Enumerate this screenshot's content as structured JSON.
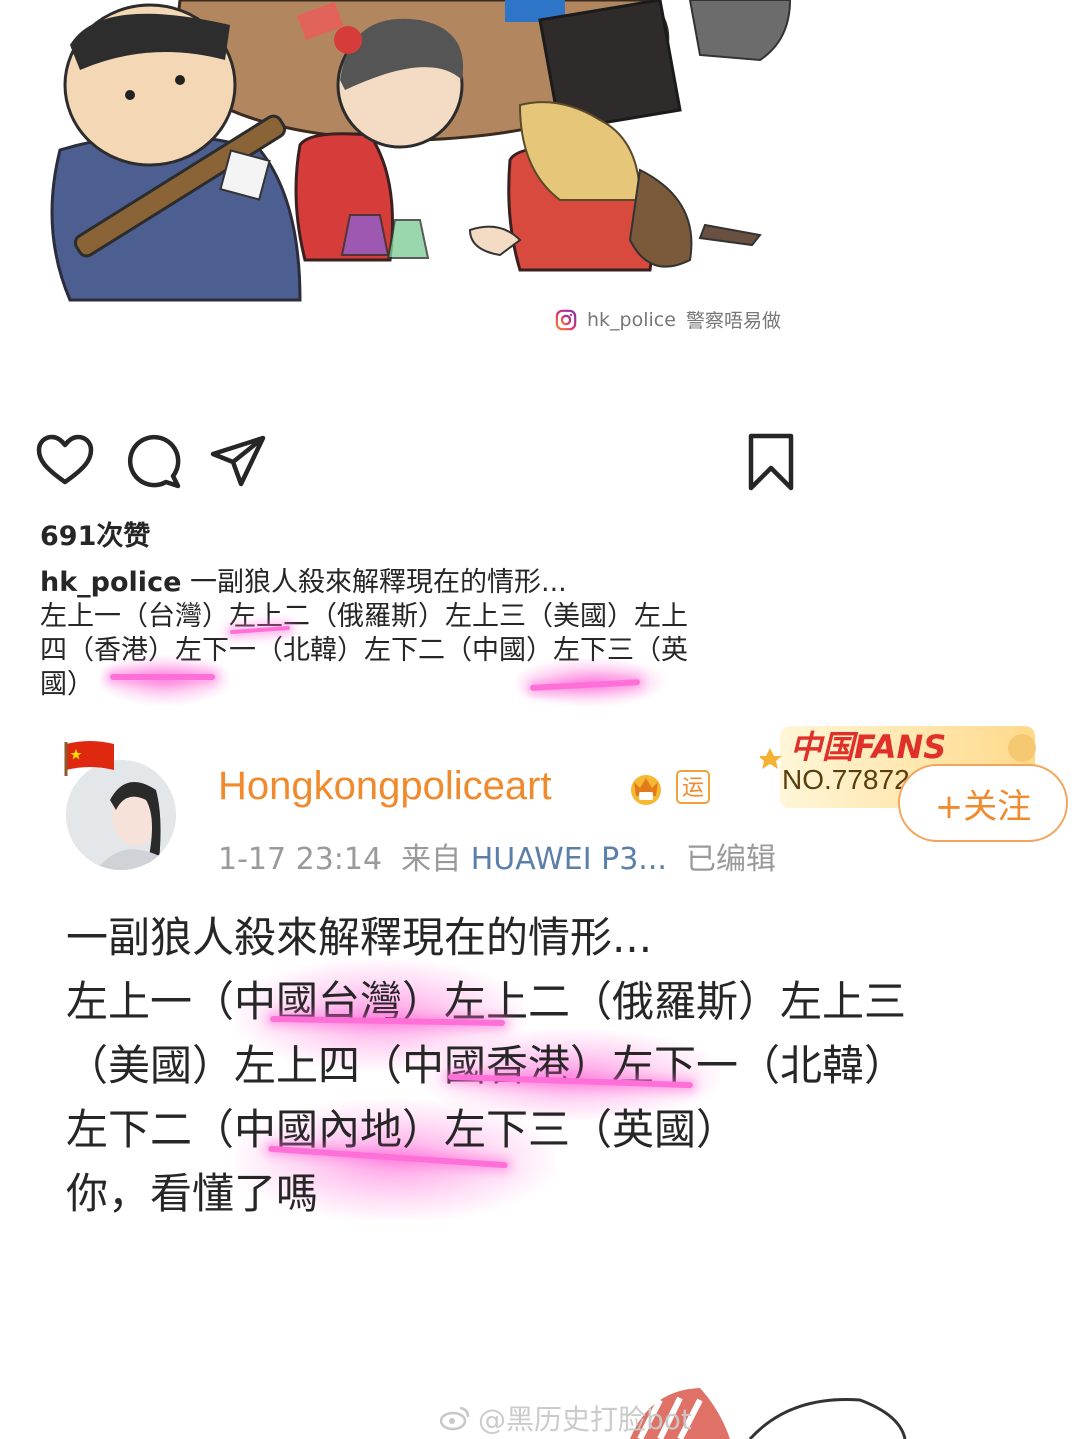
{
  "illustration": {
    "credit_handle": "hk_police",
    "credit_text": "警察唔易做",
    "icons": [
      "instagram-icon"
    ]
  },
  "instagram": {
    "actions": [
      "heart-icon",
      "comment-icon",
      "share-icon",
      "bookmark-icon"
    ],
    "likes": "691次赞",
    "caption_user": "hk_police",
    "caption_title": "一副狼人殺來解釋現在的情形...",
    "caption_lines": [
      "左上一（台灣）左上二（俄羅斯）左上三（美國）左上",
      "四（香港）左下一（北韓）左下二（中國）左下三（英",
      "國）"
    ]
  },
  "weibo": {
    "username": "Hongkongpoliceart",
    "badge_yun": "运",
    "fans_title": "中国FANS",
    "fans_no": "NO.77872",
    "follow_label": "+关注",
    "time": "1-17 23:14",
    "from_label": "来自",
    "source": "HUAWEI P3...",
    "edited": "已编辑",
    "body_lines": [
      "一副狼人殺來解釋現在的情形...",
      "左上一（中國台灣）左上二（俄羅斯）左上三",
      "（美國）左上四（中國香港）左下一（北韓）",
      "左下二（中國內地）左下三（英國）",
      "你，看懂了嗎"
    ],
    "colors": {
      "username": "#f08a2c",
      "highlight": "#ff6fd8",
      "source_link": "#5b7fa8"
    }
  },
  "watermark": "@黑历史打脸bot"
}
